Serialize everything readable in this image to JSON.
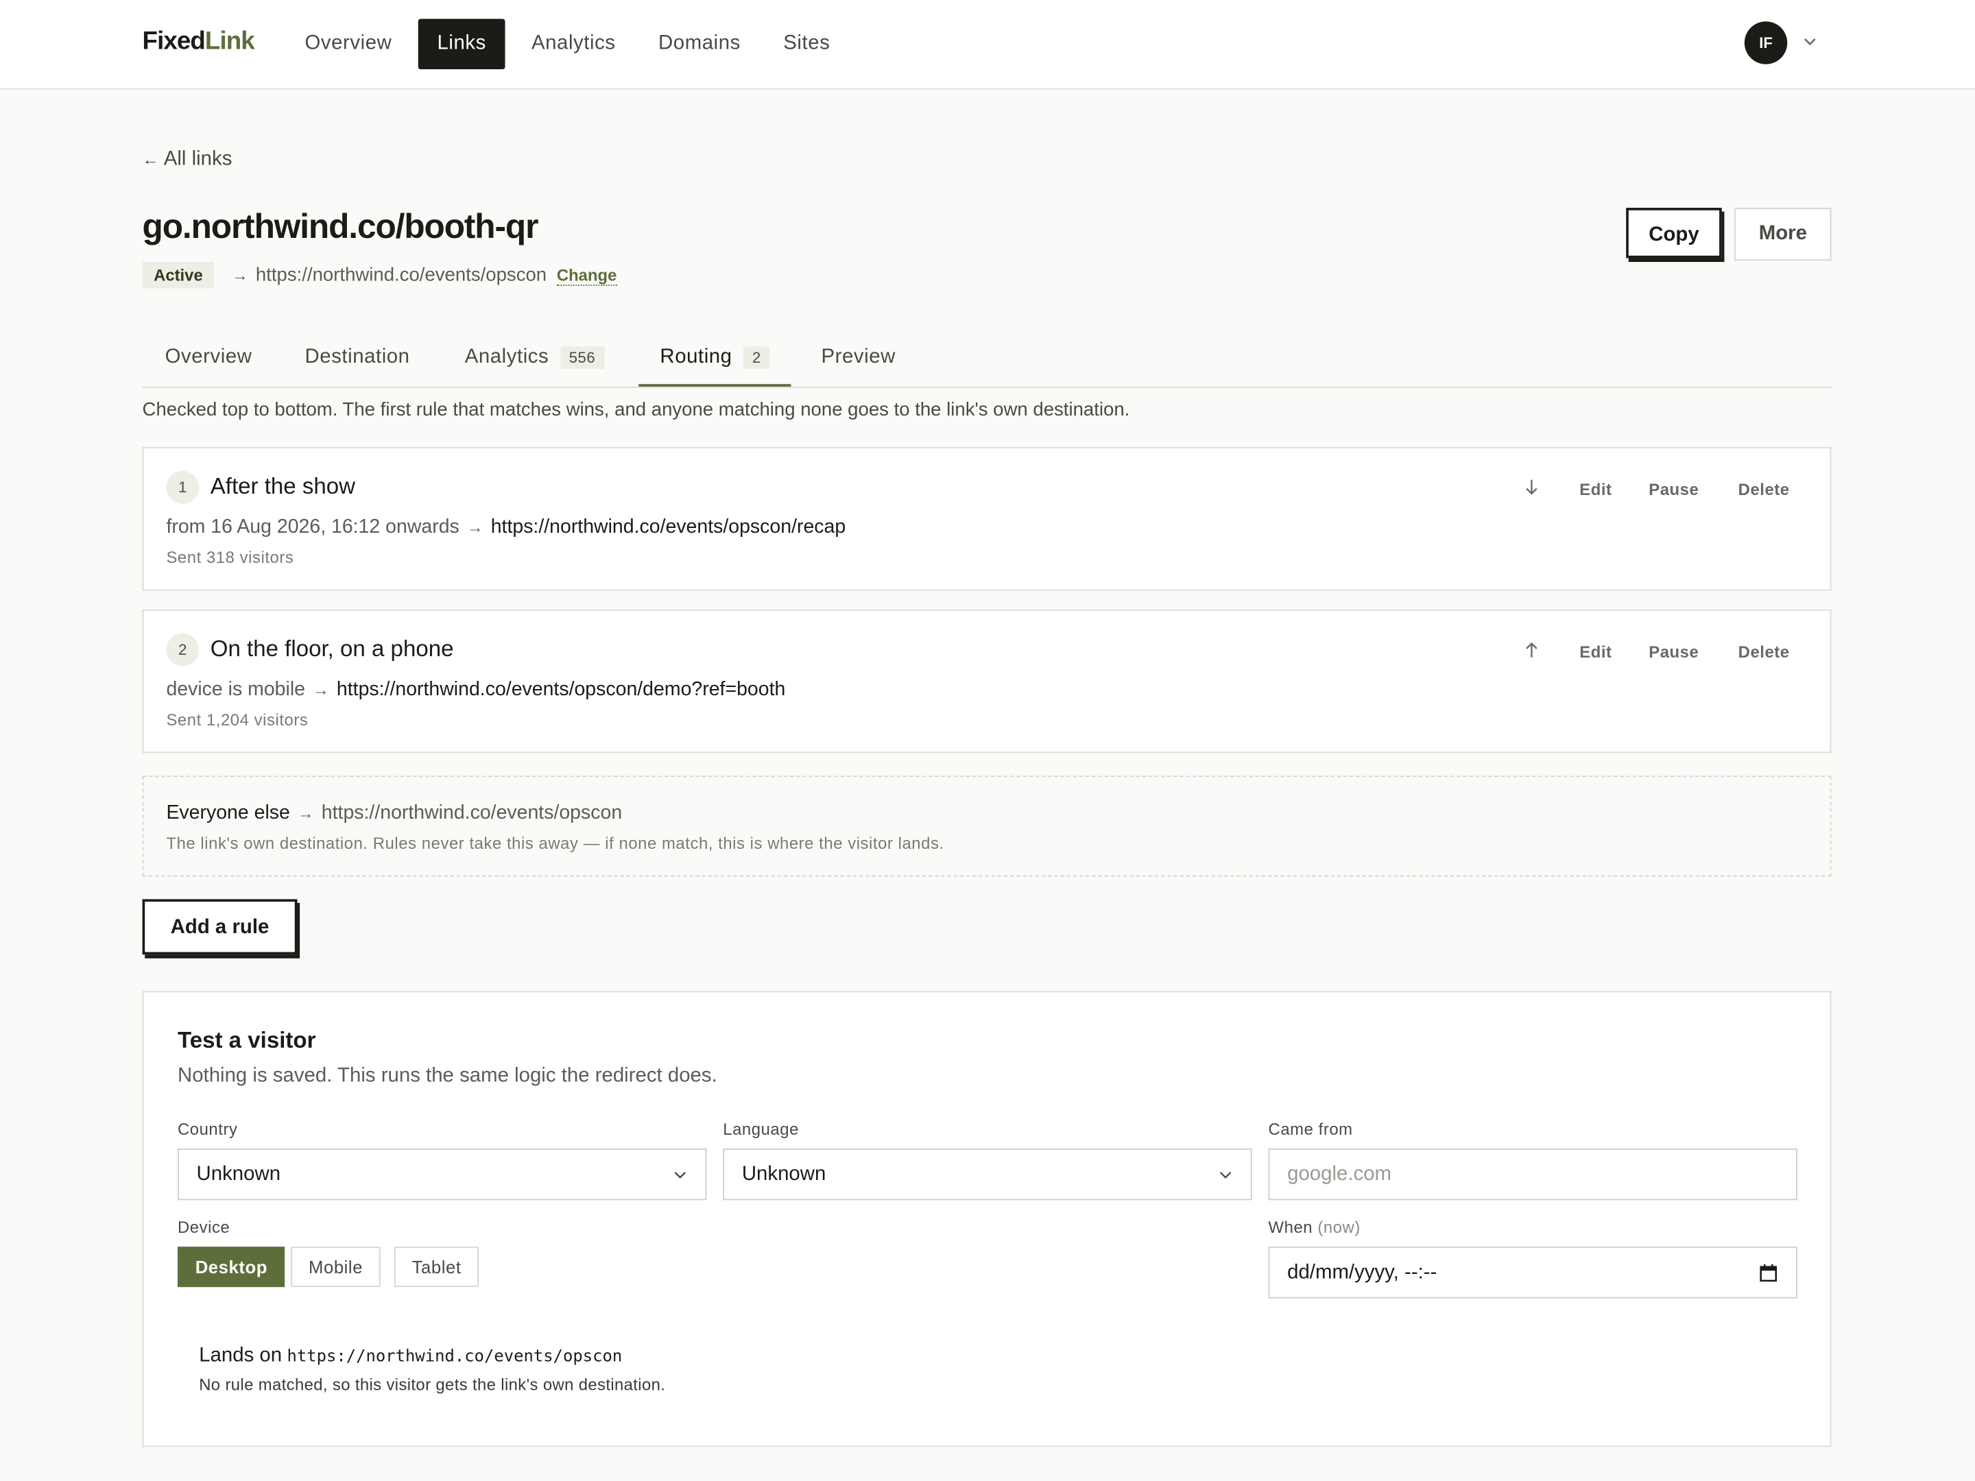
{
  "app": {
    "logo_a": "Fixed",
    "logo_b": "Link"
  },
  "nav": {
    "items": [
      "Overview",
      "Links",
      "Analytics",
      "Domains",
      "Sites"
    ],
    "active": "Links",
    "avatar": "IF"
  },
  "colors": {
    "accent": "#5e6e3b",
    "ink": "#1c1b18"
  },
  "header": {
    "back_label": "All links",
    "short_link": "go.northwind.co/booth-qr",
    "status": "Active",
    "destination": "https://northwind.co/events/opscon",
    "change_label": "Change",
    "copy_label": "Copy",
    "more_label": "More"
  },
  "tabs": [
    {
      "label": "Overview"
    },
    {
      "label": "Destination"
    },
    {
      "label": "Analytics",
      "count": "556"
    },
    {
      "label": "Routing",
      "count": "2"
    },
    {
      "label": "Preview"
    }
  ],
  "active_tab": "Routing",
  "intro": "Checked top to bottom. The first rule that matches wins, and anyone matching none goes to the link's own destination.",
  "rules": [
    {
      "num": "1",
      "name": "After the show",
      "condition": "from 16 Aug 2026, 16:12 onwards",
      "target": "https://northwind.co/events/opscon/recap",
      "sent": "Sent 318 visitors",
      "move_icon": "arrow-down-icon",
      "actions": [
        "Edit",
        "Pause",
        "Delete"
      ]
    },
    {
      "num": "2",
      "name": "On the floor, on a phone",
      "condition": "device is mobile",
      "target": "https://northwind.co/events/opscon/demo?ref=booth",
      "sent": "Sent 1,204 visitors",
      "move_icon": "arrow-up-icon",
      "actions": [
        "Edit",
        "Pause",
        "Delete"
      ]
    }
  ],
  "fallback": {
    "label": "Everyone else",
    "target": "https://northwind.co/events/opscon",
    "note": "The link's own destination. Rules never take this away — if none match, this is where the visitor lands."
  },
  "add_rule_label": "Add a rule",
  "test": {
    "title": "Test a visitor",
    "subtitle": "Nothing is saved. This runs the same logic the redirect does.",
    "country_label": "Country",
    "country_value": "Unknown",
    "language_label": "Language",
    "language_value": "Unknown",
    "came_from_label": "Came from",
    "came_from_placeholder": "google.com",
    "device_label": "Device",
    "devices": [
      "Desktop",
      "Mobile",
      "Tablet"
    ],
    "device_selected": "Desktop",
    "when_label": "When",
    "when_hint": "(now)",
    "when_value": "dd/mm/yyyy, --:--",
    "result_prefix": "Lands on",
    "result_url": "https://northwind.co/events/opscon",
    "result_note": "No rule matched, so this visitor gets the link's own destination."
  }
}
